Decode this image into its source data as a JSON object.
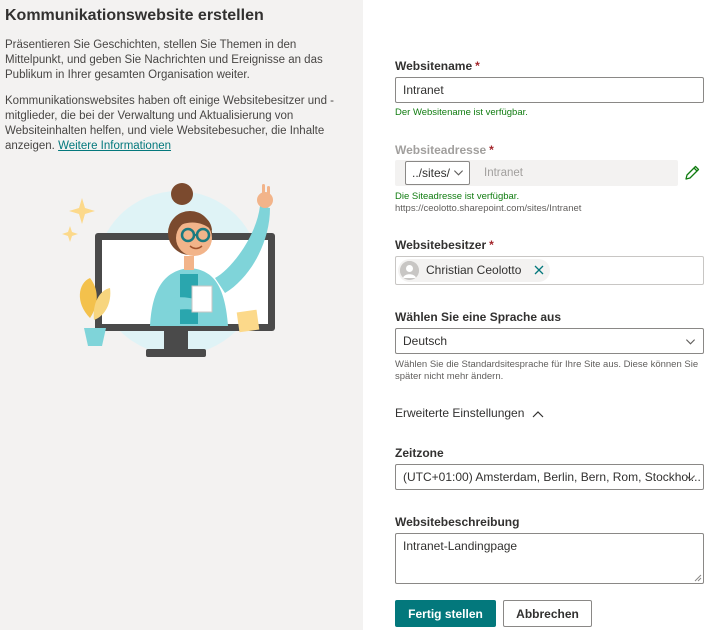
{
  "left": {
    "title": "Kommunikationswebsite erstellen",
    "description_1": "Präsentieren Sie Geschichten, stellen Sie Themen in den Mittelpunkt, und geben Sie Nachrichten und Ereignisse an das Publikum in Ihrer gesamten Organisation weiter.",
    "description_2": "Kommunikationswebsites haben oft einige Websitebesitzer und -mitglieder, die bei der Verwaltung und Aktualisierung von Websiteinhalten helfen, und viele Websitebesucher, die Inhalte anzeigen.",
    "learn_more": "Weitere Informationen"
  },
  "form": {
    "site_name": {
      "label": "Websitename",
      "required_mark": "*",
      "value": "Intranet",
      "status": "Der Websitename ist verfügbar."
    },
    "site_address": {
      "label": "Websiteadresse",
      "required_mark": "*",
      "prefix_option": "../sites/",
      "value": "Intranet",
      "status": "Die Siteadresse ist verfügbar.",
      "full_url": "https://ceolotto.sharepoint.com/sites/Intranet",
      "edit_icon": "pencil-icon"
    },
    "site_owner": {
      "label": "Websitebesitzer",
      "required_mark": "*",
      "owner_name": "Christian Ceolotto",
      "remove_icon": "close-icon"
    },
    "language": {
      "label": "Wählen Sie eine Sprache aus",
      "value": "Deutsch",
      "hint_line1": "Wählen Sie die Standardsitesprache für Ihre Site aus. Diese können Sie",
      "hint_line2": "später nicht mehr ändern."
    },
    "advanced": {
      "label": "Erweiterte Einstellungen",
      "icon": "chevron-up-icon"
    },
    "timezone": {
      "label": "Zeitzone",
      "value": "(UTC+01:00) Amsterdam, Berlin, Bern, Rom, Stockhol..."
    },
    "description": {
      "label": "Websitebeschreibung",
      "value": "Intranet-Landingpage"
    }
  },
  "buttons": {
    "finish": "Fertig stellen",
    "cancel": "Abbrechen"
  },
  "colors": {
    "accent": "#03787c",
    "success": "#107c10",
    "required": "#a4262c",
    "left_panel_bg": "#f3f2f1"
  }
}
